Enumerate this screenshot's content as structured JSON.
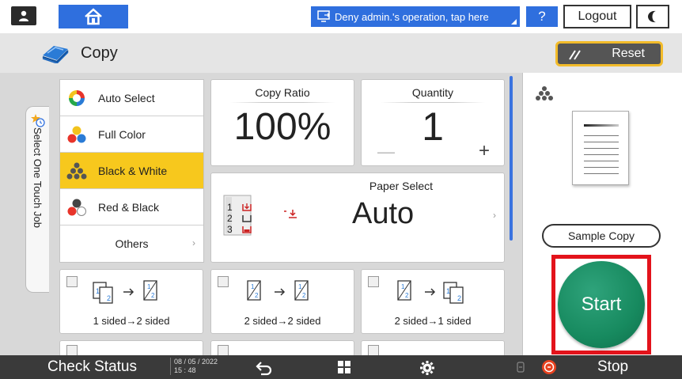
{
  "topbar": {
    "notice_text": "Deny admin.'s operation, tap here",
    "help_label": "?",
    "logout_label": "Logout"
  },
  "app": {
    "title": "Copy",
    "reset_label": "Reset"
  },
  "side_tab": {
    "label": "Select One Touch Job"
  },
  "color_modes": {
    "items": [
      {
        "label": "Auto Select",
        "icon": "auto-select-icon"
      },
      {
        "label": "Full Color",
        "icon": "full-color-icon"
      },
      {
        "label": "Black & White",
        "icon": "black-white-icon",
        "selected": true
      },
      {
        "label": "Red & Black",
        "icon": "red-black-icon"
      }
    ],
    "others_label": "Others"
  },
  "copy_ratio": {
    "label": "Copy Ratio",
    "value": "100%"
  },
  "quantity": {
    "label": "Quantity",
    "value": "1",
    "minus": "—",
    "plus": "+"
  },
  "paper_select": {
    "label": "Paper Select",
    "value": "Auto",
    "trays": [
      "1",
      "2",
      "3"
    ]
  },
  "duplex": [
    {
      "label": "1 sided→2 sided"
    },
    {
      "label": "2 sided→2 sided"
    },
    {
      "label": "2 sided→1 sided"
    }
  ],
  "preview": {
    "sample_copy_label": "Sample Copy",
    "start_label": "Start"
  },
  "bottombar": {
    "check_status_label": "Check Status",
    "date": "08 / 05 / 2022",
    "time": "15 : 48",
    "stop_label": "Stop"
  },
  "colors": {
    "accent_blue": "#2f6fde",
    "selected_yellow": "#f7c81d",
    "start_green": "#178a5f",
    "highlight_red": "#e3131b"
  }
}
